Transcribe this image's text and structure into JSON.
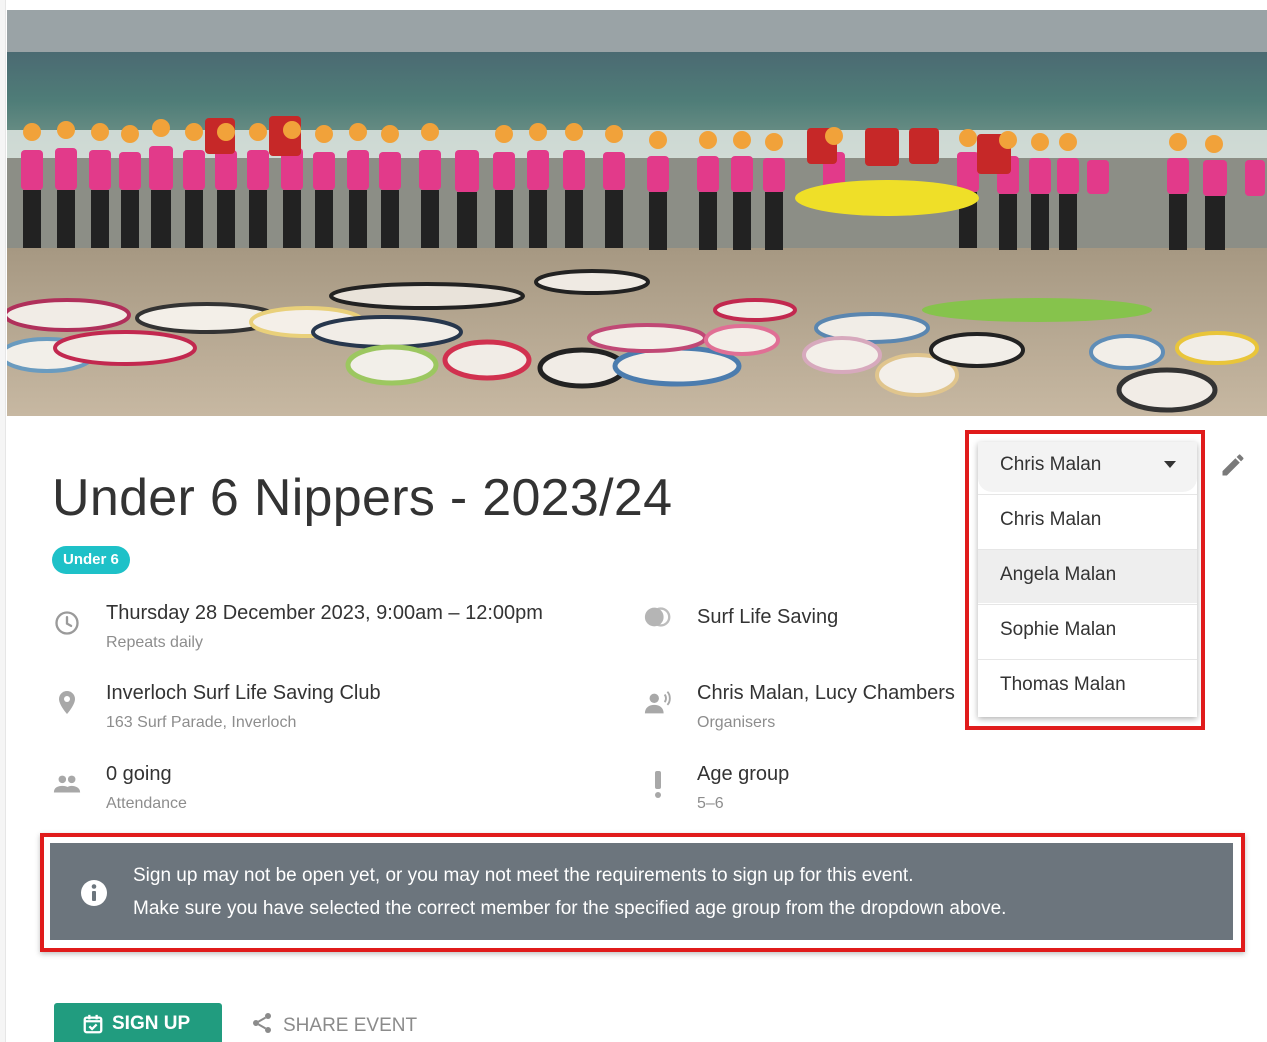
{
  "event": {
    "title": "Under 6 Nippers - 2023/24",
    "tag": "Under 6",
    "datetime": "Thursday 28 December 2023, 9:00am – 12:00pm",
    "recurrence": "Repeats daily",
    "activity": "Surf Life Saving",
    "location_name": "Inverloch Surf Life Saving Club",
    "location_address": "163 Surf Parade, Inverloch",
    "organisers": "Chris Malan, Lucy Chambers",
    "organisers_label": "Organisers",
    "attendance": "0 going",
    "attendance_label": "Attendance",
    "age_group_label": "Age group",
    "age_group": "5–6"
  },
  "notice": {
    "line1": "Sign up may not be open yet, or you may not meet the requirements to sign up for this event.",
    "line2": "Make sure you have selected the correct member for the specified age group from the dropdown above."
  },
  "actions": {
    "sign_up": "SIGN UP",
    "share": "SHARE EVENT"
  },
  "member_select": {
    "selected": "Chris Malan",
    "options": [
      "Chris Malan",
      "Angela Malan",
      "Sophie Malan",
      "Thomas Malan"
    ],
    "highlighted": "Angela Malan"
  },
  "colors": {
    "tag": "#1ec1c8",
    "sign_up": "#219c7f",
    "notice": "#6c757d",
    "highlight_outline": "#e01b1b"
  },
  "icons": {
    "datetime": "clock-icon",
    "activity": "toggle-icon",
    "location": "map-pin-icon",
    "organisers": "speaker-person-icon",
    "attendance": "people-icon",
    "age_group": "exclamation-icon",
    "notice": "info-icon",
    "sign_up": "calendar-check-icon",
    "share": "share-icon",
    "edit": "pencil-icon",
    "dropdown": "caret-down-icon"
  }
}
